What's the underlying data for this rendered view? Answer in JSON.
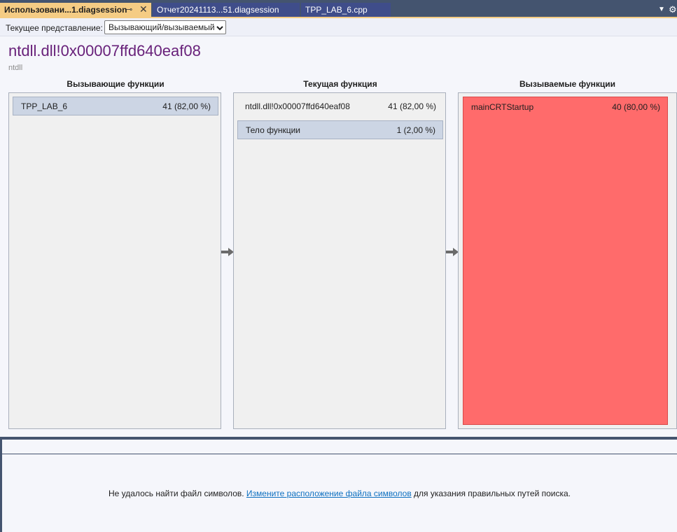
{
  "tabs": [
    {
      "label": "Использовани...1.diagsession",
      "active": true,
      "pin_glyph": "⊸",
      "close_glyph": "✕"
    },
    {
      "label": "Отчет20241113...51.diagsession",
      "active": false
    },
    {
      "label": "TPP_LAB_6.cpp",
      "active": false
    }
  ],
  "tabbar_icons": {
    "dropdown": "▼",
    "settings": "⚙"
  },
  "toolbar": {
    "view_label": "Текущее представление:",
    "view_value": "Вызывающий/вызываемый"
  },
  "header": {
    "function_name": "ntdll.dll!0x00007ffd640eaf08",
    "module": "ntdll"
  },
  "columns": {
    "callers_title": "Вызывающие функции",
    "current_title": "Текущая функция",
    "callees_title": "Вызываемые функции"
  },
  "callers": [
    {
      "name": "TPP_LAB_6",
      "value": "41 (82,00 %)"
    }
  ],
  "current": {
    "name": "ntdll.dll!0x00007ffd640eaf08",
    "value": "41 (82,00 %)",
    "body_label": "Тело функции",
    "body_value": "1 (2,00 %)"
  },
  "callees": [
    {
      "name": "mainCRTStartup",
      "value": "40 (80,00 %)"
    }
  ],
  "message": {
    "prefix": "Не удалось найти файл символов.",
    "link": "Измените расположение файла символов",
    "suffix": "для указания правильных путей поиска."
  },
  "colors": {
    "accent_tab": "#f5cc84",
    "tabbar_bg": "#44546f",
    "title_purple": "#68217a",
    "hot_path_red": "#ff6b6b",
    "link_blue": "#0e70c0"
  }
}
